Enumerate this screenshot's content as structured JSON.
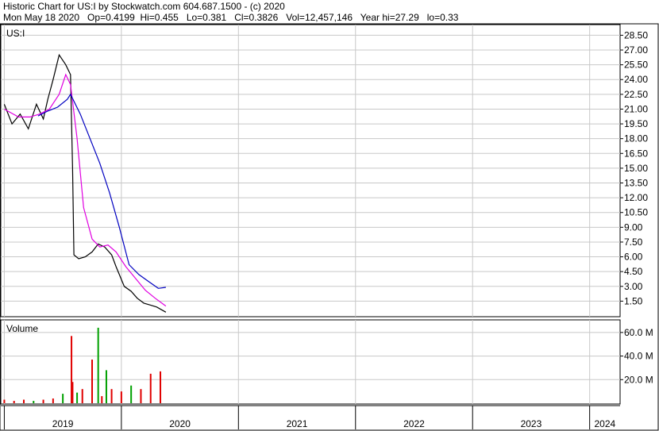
{
  "header": {
    "line1": "Historic Chart for US:I by Stockwatch.com 604.687.1500 - (c) 2020",
    "line2": "Mon May 18 2020   Op=0.4199  Hi=0.455   Lo=0.381   Cl=0.3826   Vol=12,457,146   Year hi=27.29   lo=0.33"
  },
  "chart_data": [
    {
      "type": "line",
      "title": "US:I",
      "ylim": [
        0,
        29.5
      ],
      "y_ticks": [
        "28.50",
        "27.00",
        "25.50",
        "24.00",
        "22.50",
        "21.00",
        "19.50",
        "18.00",
        "16.50",
        "15.00",
        "13.50",
        "12.00",
        "10.50",
        "9.00",
        "7.50",
        "6.00",
        "4.50",
        "3.00",
        "1.50"
      ],
      "x_ticks": [
        "2019",
        "2020",
        "2021",
        "2022",
        "2023",
        "2024"
      ],
      "colors": {
        "price": "#000000",
        "ma_short": "#e000e0",
        "ma_long": "#0000c0"
      },
      "series": [
        {
          "name": "",
          "x": [
            "2019-01-01",
            "2019-01-25",
            "2019-02-20",
            "2019-03-15",
            "2019-04-10",
            "2019-05-01",
            "2019-05-15",
            "2019-06-01",
            "2019-06-20",
            "2019-07-10",
            "2019-07-25",
            "2019-08-01",
            "2019-08-05",
            "2019-08-20",
            "2019-09-10",
            "2019-10-01",
            "2019-10-20",
            "2019-11-10",
            "2019-12-01",
            "2019-12-15",
            "2020-01-10",
            "2020-02-01",
            "2020-02-20",
            "2020-03-10",
            "2020-04-01",
            "2020-04-20",
            "2020-05-18"
          ],
          "values": [
            21.5,
            19.5,
            20.5,
            19.0,
            21.5,
            20.0,
            22.0,
            24.0,
            26.5,
            25.5,
            24.5,
            15.0,
            6.2,
            5.8,
            6.0,
            6.5,
            7.3,
            7.0,
            6.2,
            5.0,
            3.0,
            2.5,
            1.8,
            1.3,
            1.1,
            0.9,
            0.38
          ]
        },
        {
          "name": "",
          "x": [
            "2019-01-01",
            "2019-02-15",
            "2019-03-20",
            "2019-04-20",
            "2019-05-20",
            "2019-06-20",
            "2019-07-10",
            "2019-07-25",
            "2019-08-15",
            "2019-09-05",
            "2019-10-01",
            "2019-10-25",
            "2019-11-20",
            "2019-12-15",
            "2020-01-15",
            "2020-02-15",
            "2020-03-15",
            "2020-04-15",
            "2020-05-18"
          ],
          "values": [
            21.0,
            20.2,
            20.2,
            20.5,
            21.0,
            22.5,
            24.5,
            23.5,
            18.0,
            11.0,
            7.8,
            7.0,
            7.2,
            6.5,
            5.0,
            3.8,
            2.6,
            1.8,
            1.0
          ]
        },
        {
          "name": "",
          "x": [
            "2019-04-15",
            "2019-05-15",
            "2019-06-15",
            "2019-07-15",
            "2019-07-25",
            "2019-08-25",
            "2019-09-25",
            "2019-10-25",
            "2019-11-25",
            "2019-12-25",
            "2020-01-25",
            "2020-02-25",
            "2020-03-25",
            "2020-04-25",
            "2020-05-18"
          ],
          "values": [
            20.3,
            20.8,
            21.2,
            22.0,
            22.5,
            20.5,
            18.0,
            15.5,
            12.5,
            9.0,
            5.2,
            4.2,
            3.5,
            2.8,
            2.9
          ]
        }
      ]
    },
    {
      "type": "bar",
      "title": "Volume",
      "ylim": [
        0,
        70
      ],
      "y_ticks": [
        "60.0 M",
        "40.0 M",
        "20.0 M"
      ],
      "colors": {
        "up": "#00a000",
        "down": "#e00000"
      },
      "series": [
        {
          "name": "",
          "x": [
            "2019-01",
            "2019-02",
            "2019-03",
            "2019-04",
            "2019-05",
            "2019-06",
            "2019-07",
            "2019-07-28",
            "2019-08",
            "2019-08-15",
            "2019-09",
            "2019-10",
            "2019-10-20",
            "2019-11",
            "2019-11-15",
            "2019-12",
            "2020-01",
            "2020-02",
            "2020-03",
            "2020-04",
            "2020-05"
          ],
          "values": [
            3,
            2,
            3,
            2,
            3,
            4,
            8,
            57,
            18,
            9,
            12,
            37,
            64,
            6,
            28,
            12,
            10,
            15,
            12,
            25,
            27
          ],
          "direction": [
            "down",
            "down",
            "down",
            "up",
            "down",
            "down",
            "up",
            "down",
            "down",
            "up",
            "down",
            "down",
            "up",
            "down",
            "up",
            "down",
            "down",
            "up",
            "down",
            "down",
            "down"
          ]
        }
      ]
    }
  ]
}
